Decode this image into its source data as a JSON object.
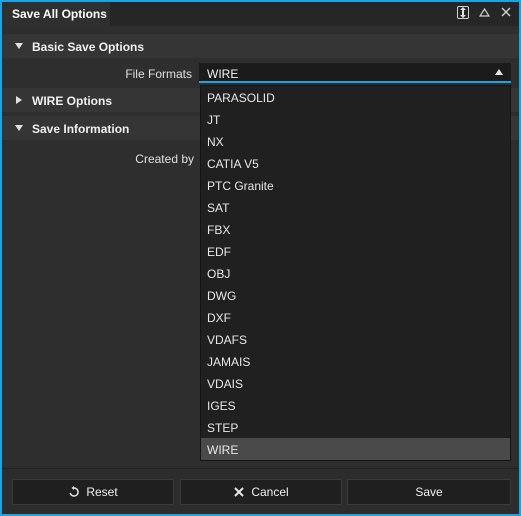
{
  "window": {
    "title": "Save All Options"
  },
  "sections": {
    "basic": {
      "label": "Basic Save Options",
      "expanded": true
    },
    "wire": {
      "label": "WIRE Options",
      "expanded": false
    },
    "info": {
      "label": "Save Information",
      "expanded": true
    }
  },
  "fields": {
    "file_formats": {
      "label": "File Formats",
      "value": "WIRE"
    },
    "created_by": {
      "label": "Created by"
    }
  },
  "dropdown": {
    "options": [
      "PARASOLID",
      "JT",
      "NX",
      "CATIA V5",
      "PTC Granite",
      "SAT",
      "FBX",
      "EDF",
      "OBJ",
      "DWG",
      "DXF",
      "VDAFS",
      "JAMAIS",
      "VDAIS",
      "IGES",
      "STEP",
      "WIRE"
    ],
    "selected": "WIRE"
  },
  "buttons": {
    "reset": "Reset",
    "cancel": "Cancel",
    "save": "Save"
  },
  "colors": {
    "accent": "#1fa3e0",
    "background": "#2e2e2e",
    "section_header": "#353535",
    "dropdown_bg": "#202020",
    "selected_option": "#4a4a4a"
  },
  "icons": {
    "dock": "dock-icon",
    "collapse": "collapse-icon",
    "close": "close-icon",
    "reset": "reset-icon",
    "cancel": "cancel-icon"
  }
}
